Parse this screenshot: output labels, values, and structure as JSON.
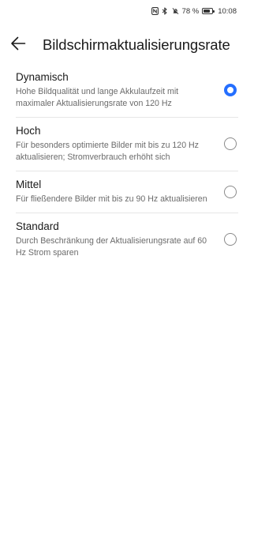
{
  "status_bar": {
    "icons": [
      "nfc-icon",
      "bluetooth-icon",
      "mute-icon"
    ],
    "battery_percent": "78 %",
    "battery_level": 0.78,
    "time": "10:08"
  },
  "header": {
    "back_icon": "arrow-left-icon",
    "title": "Bildschirmaktualisierungsrate"
  },
  "options": [
    {
      "title": "Dynamisch",
      "description": "Hohe Bildqualität und lange Akkulaufzeit mit maximaler Aktualisierungsrate von 120 Hz",
      "selected": true
    },
    {
      "title": "Hoch",
      "description": "Für besonders optimierte Bilder mit bis zu 120 Hz aktualisieren; Stromverbrauch erhöht sich",
      "selected": false
    },
    {
      "title": "Mittel",
      "description": "Für fließendere Bilder mit bis zu 90 Hz aktualisieren",
      "selected": false
    },
    {
      "title": "Standard",
      "description": "Durch Beschränkung der Aktualisierungsrate auf 60 Hz Strom sparen",
      "selected": false
    }
  ],
  "colors": {
    "accent": "#256fff",
    "background": "#ffffff",
    "text_primary": "#1a1a1a",
    "text_secondary": "#6b6b6b",
    "divider": "#e6e6e6"
  }
}
